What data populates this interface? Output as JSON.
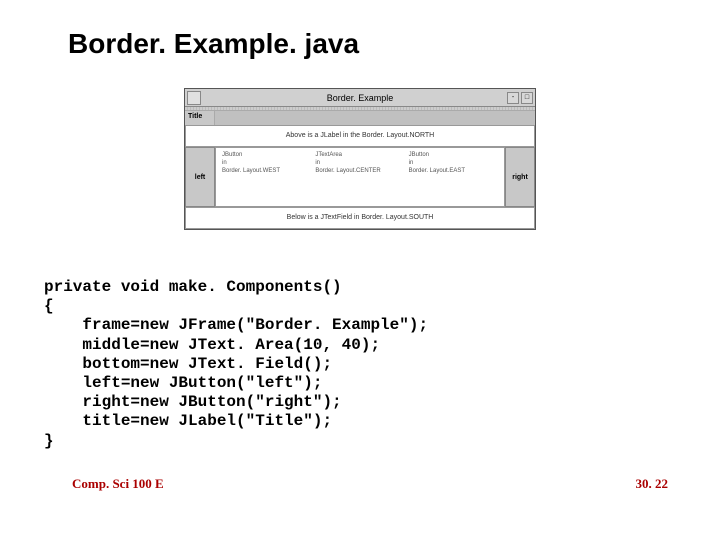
{
  "slide": {
    "title": "Border. Example. java"
  },
  "window": {
    "title": "Border. Example",
    "label_title": "Title",
    "north": "Above is a JLabel in the Border. Layout.NORTH",
    "left": "left",
    "right": "right",
    "south": "Below is a JTextField in Border. Layout.SOUTH",
    "center_cols": {
      "c1a": "JButton",
      "c1b": "in",
      "c1c": "Border. Layout.WEST",
      "c2a": "JTextArea",
      "c2b": "in",
      "c2c": "Border. Layout.CENTER",
      "c3a": "JButton",
      "c3b": "in",
      "c3c": "Border. Layout.EAST"
    }
  },
  "code": {
    "l1": "private void make. Components()",
    "l2": "{",
    "l3": "    frame=new JFrame(\"Border. Example\");",
    "l4": "    middle=new JText. Area(10, 40);",
    "l5": "    bottom=new JText. Field();",
    "l6": "    left=new JButton(\"left\");",
    "l7": "    right=new JButton(\"right\");",
    "l8": "    title=new JLabel(\"Title\");",
    "l9": "}"
  },
  "footer": {
    "left": "Comp. Sci 100 E",
    "right": "30. 22"
  }
}
